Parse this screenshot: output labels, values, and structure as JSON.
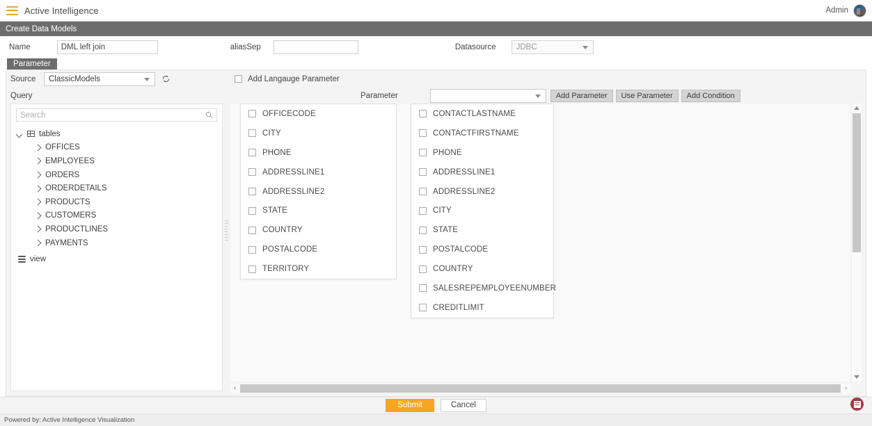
{
  "topbar": {
    "menu_icon": "hamburger-icon",
    "app_title": "Active Intelligence",
    "admin_label": "Admin",
    "avatar_icon": "user-avatar"
  },
  "page_header": {
    "title": "Create Data Models"
  },
  "form": {
    "name_label": "Name",
    "name_value": "DML left join",
    "aliassep_label": "aliasSep",
    "aliassep_value": "",
    "datasource_label": "Datasource",
    "datasource_value": "JDBC",
    "datasource_options": [
      "JDBC"
    ]
  },
  "tabs": [
    {
      "label": "Parameter",
      "active": true
    }
  ],
  "panel": {
    "source_label": "Source",
    "source_value": "ClassicModels",
    "source_options": [
      "ClassicModels"
    ],
    "refresh_icon": "refresh-icon",
    "query_label": "Query",
    "add_language_parameter_label": "Add Langauge Parameter",
    "add_language_parameter_checked": false,
    "parameter_label": "Parameter",
    "parameter_value": "",
    "buttons": {
      "add_parameter": "Add Parameter",
      "use_parameter": "Use Parameter",
      "add_condition": "Add Condition"
    }
  },
  "tree_panel": {
    "search_placeholder": "Search",
    "search_value": "",
    "search_icon": "search-icon",
    "nodes": [
      {
        "label": "tables",
        "icon": "table-icon",
        "expanded": true,
        "level": 0
      },
      {
        "label": "OFFICES",
        "icon": "chevron-right-icon",
        "expanded": false,
        "level": 1
      },
      {
        "label": "EMPLOYEES",
        "icon": "chevron-right-icon",
        "expanded": false,
        "level": 1
      },
      {
        "label": "ORDERS",
        "icon": "chevron-right-icon",
        "expanded": false,
        "level": 1
      },
      {
        "label": "ORDERDETAILS",
        "icon": "chevron-right-icon",
        "expanded": false,
        "level": 1
      },
      {
        "label": "PRODUCTS",
        "icon": "chevron-right-icon",
        "expanded": false,
        "level": 1
      },
      {
        "label": "CUSTOMERS",
        "icon": "chevron-right-icon",
        "expanded": false,
        "level": 1
      },
      {
        "label": "PRODUCTLINES",
        "icon": "chevron-right-icon",
        "expanded": false,
        "level": 1
      },
      {
        "label": "PAYMENTS",
        "icon": "chevron-right-icon",
        "expanded": false,
        "level": 1
      },
      {
        "label": "view",
        "icon": "view-icon",
        "expanded": false,
        "level": 0
      }
    ]
  },
  "column_lists": [
    {
      "name": "offices-columns",
      "items": [
        {
          "label": "OFFICECODE",
          "checked": false
        },
        {
          "label": "CITY",
          "checked": false
        },
        {
          "label": "PHONE",
          "checked": false
        },
        {
          "label": "ADDRESSLINE1",
          "checked": false
        },
        {
          "label": "ADDRESSLINE2",
          "checked": false
        },
        {
          "label": "STATE",
          "checked": false
        },
        {
          "label": "COUNTRY",
          "checked": false
        },
        {
          "label": "POSTALCODE",
          "checked": false
        },
        {
          "label": "TERRITORY",
          "checked": false
        }
      ]
    },
    {
      "name": "customers-columns",
      "items": [
        {
          "label": "CONTACTLASTNAME",
          "checked": false
        },
        {
          "label": "CONTACTFIRSTNAME",
          "checked": false
        },
        {
          "label": "PHONE",
          "checked": false
        },
        {
          "label": "ADDRESSLINE1",
          "checked": false
        },
        {
          "label": "ADDRESSLINE2",
          "checked": false
        },
        {
          "label": "CITY",
          "checked": false
        },
        {
          "label": "STATE",
          "checked": false
        },
        {
          "label": "POSTALCODE",
          "checked": false
        },
        {
          "label": "COUNTRY",
          "checked": false
        },
        {
          "label": "SALESREPEMPLOYEENUMBER",
          "checked": false
        },
        {
          "label": "CREDITLIMIT",
          "checked": false
        }
      ]
    }
  ],
  "actions": {
    "submit_label": "Submit",
    "cancel_label": "Cancel"
  },
  "footer": {
    "text": "Powered by: Active Intelligence Visualization"
  },
  "fab": {
    "icon": "feedback-icon"
  },
  "colors": {
    "accent_orange": "#f5a623",
    "header_gray": "#6d6d6d",
    "fab_red": "#a03c4a"
  }
}
